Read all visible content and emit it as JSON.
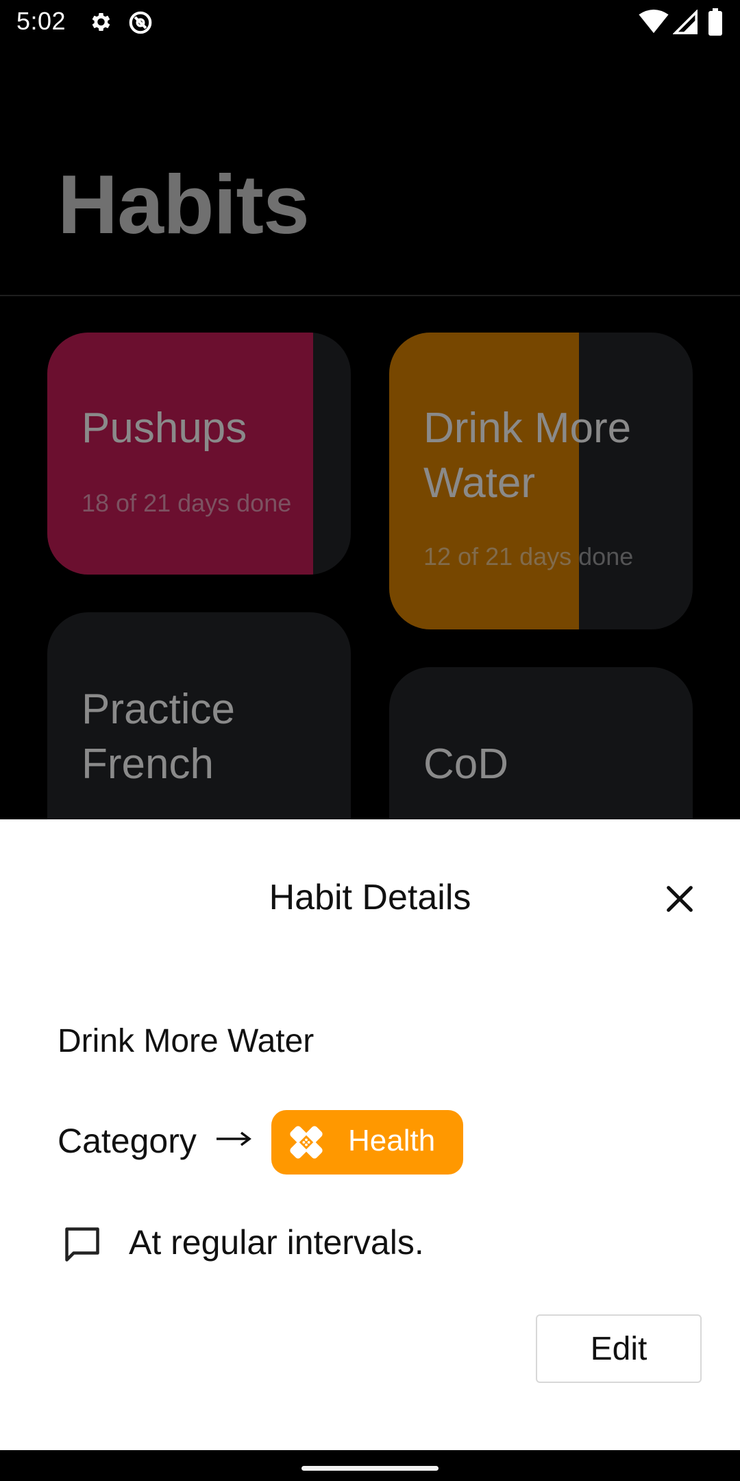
{
  "status_bar": {
    "time": "5:02",
    "icons": [
      "settings-icon",
      "data-saver-icon",
      "wifi-icon",
      "signal-icon",
      "battery-icon"
    ]
  },
  "screen": {
    "title": "Habits",
    "cards": [
      {
        "title": "Pushups",
        "subtitle": "18 of 21 days done",
        "progress_fraction": 0.857,
        "color": "#6b0f2f"
      },
      {
        "title": "Drink More Water",
        "subtitle": "12 of 21 days done",
        "progress_fraction": 0.571,
        "color": "#774700"
      },
      {
        "title": "Practice French",
        "subtitle": "",
        "color": "#131416"
      },
      {
        "title": "CoD",
        "subtitle": "",
        "color": "#131416"
      }
    ]
  },
  "sheet": {
    "title": "Habit Details",
    "habit_name": "Drink More Water",
    "category_label": "Category",
    "category_value": "Health",
    "category_icon": "bandage-icon",
    "category_color": "#ff9800",
    "note": "At regular intervals.",
    "edit_label": "Edit"
  }
}
